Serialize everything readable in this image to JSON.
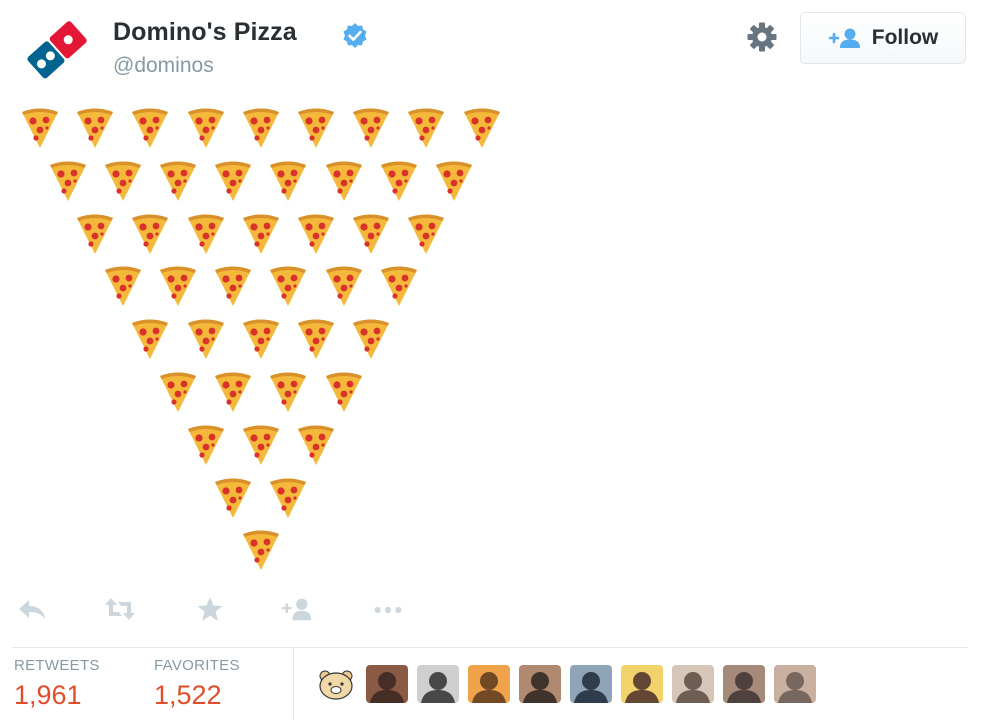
{
  "tweet": {
    "display_name": "Domino's Pizza",
    "handle": "@dominos",
    "follow_label": "Follow",
    "emoji": "pizza",
    "pizza_rows": [
      9,
      8,
      7,
      6,
      5,
      4,
      3,
      2,
      1
    ]
  },
  "icons": {
    "verified": "verified-badge-icon",
    "settings": "gear-icon",
    "follow": "add-user-icon",
    "reply": "reply-icon",
    "retweet": "retweet-icon",
    "favorite": "star-icon",
    "add_to_list": "add-user-icon",
    "more": "more-dots-icon"
  },
  "stats": {
    "retweets_label": "RETWEETS",
    "retweets_value": "1,961",
    "favorites_label": "FAVORITES",
    "favorites_value": "1,522"
  },
  "favorited_by_count": 10,
  "colors": {
    "brand_red": "#e31837",
    "brand_blue": "#006491",
    "verified_blue": "#55acee",
    "count_red": "#e14d2a",
    "muted_gray": "#8899a6",
    "action_gray": "#ccd6dd"
  }
}
